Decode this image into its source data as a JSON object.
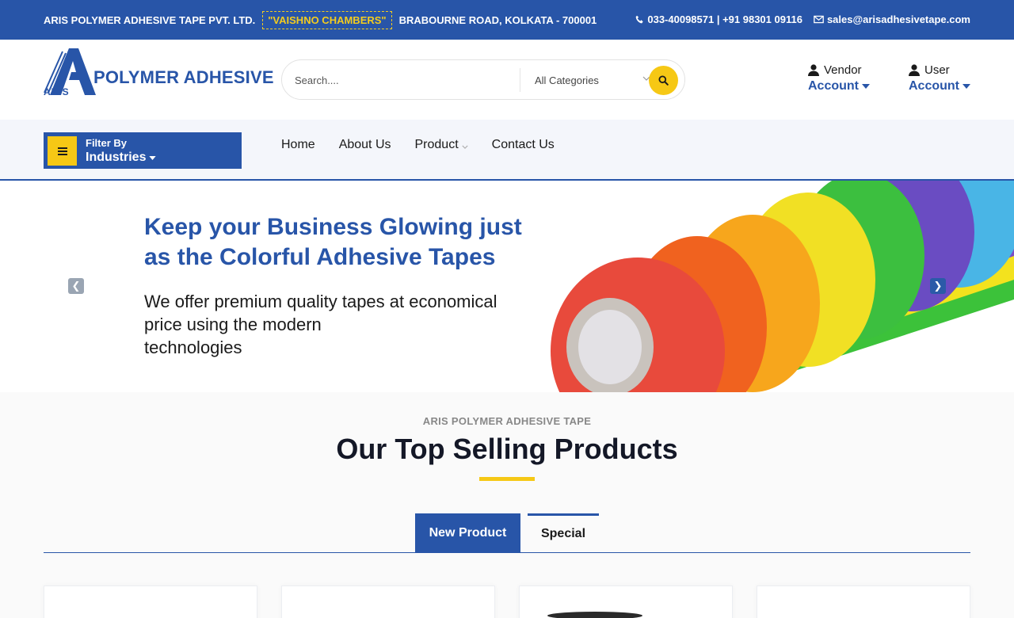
{
  "topbar": {
    "company": "ARIS POLYMER ADHESIVE TAPE PVT. LTD.",
    "building": "\"VAISHNO CHAMBERS\"",
    "address": "BRABOURNE ROAD, KOLKATA - 700001",
    "phone": "033-40098571 | +91 98301 09116",
    "email": "sales@arisadhesivetape.com",
    "phone_icon": "phone-icon",
    "email_icon": "envelope-icon"
  },
  "header": {
    "logo_text": "POLYMER ADHESIVE",
    "logo_sub": "ARIS",
    "search_placeholder": "Search....",
    "category_selected": "All Categories",
    "vendor": {
      "line1": "Vendor",
      "line2": "Account"
    },
    "user": {
      "line1": "User",
      "line2": "Account"
    }
  },
  "nav": {
    "filter_line1": "Filter By",
    "filter_line2": "Industries",
    "items": [
      "Home",
      "About Us",
      "Product",
      "Contact Us"
    ]
  },
  "hero": {
    "headline_line1": "Keep your Business Glowing just",
    "headline_line2": "as the Colorful Adhesive Tapes",
    "sub_line1": "We offer premium quality tapes at economical",
    "sub_line2": "price using the modern",
    "sub_line3": "technologies"
  },
  "products": {
    "kicker": "ARIS POLYMER ADHESIVE TAPE",
    "title": "Our Top Selling Products",
    "tabs": [
      "New Product",
      "Special"
    ]
  },
  "colors": {
    "brand_blue": "#2855a8",
    "accent_yellow": "#f6c815"
  }
}
